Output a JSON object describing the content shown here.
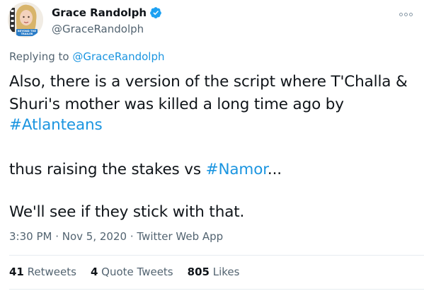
{
  "author": {
    "name": "Grace Randolph",
    "handle": "@GraceRandolph",
    "avatar_badge_text": "BEYOND THE TRAILER"
  },
  "replying": {
    "prefix": "Replying to",
    "mention": "@GraceRandolph"
  },
  "body": {
    "line1": "Also, there is a version of the script where T'Challa &",
    "line2": "Shuri's mother was killed a long time ago by",
    "hashtag1": "#Atlanteans",
    "line4_prefix": "thus raising the stakes vs ",
    "hashtag2": "#Namor",
    "line4_suffix": "...",
    "line5": "We'll see if they stick with that."
  },
  "meta": {
    "time": "3:30 PM",
    "sep1": " · ",
    "date": "Nov 5, 2020",
    "sep2": " · ",
    "source": "Twitter Web App"
  },
  "stats": {
    "retweets_count": "41",
    "retweets_label": "Retweets",
    "quotes_count": "4",
    "quotes_label": "Quote Tweets",
    "likes_count": "805",
    "likes_label": "Likes"
  },
  "colors": {
    "link": "#1b95e0",
    "secondary_text": "#536471",
    "verified": "#1da1f2"
  },
  "icons": {
    "verified": "verified-badge-icon",
    "more": "more-options-icon"
  }
}
